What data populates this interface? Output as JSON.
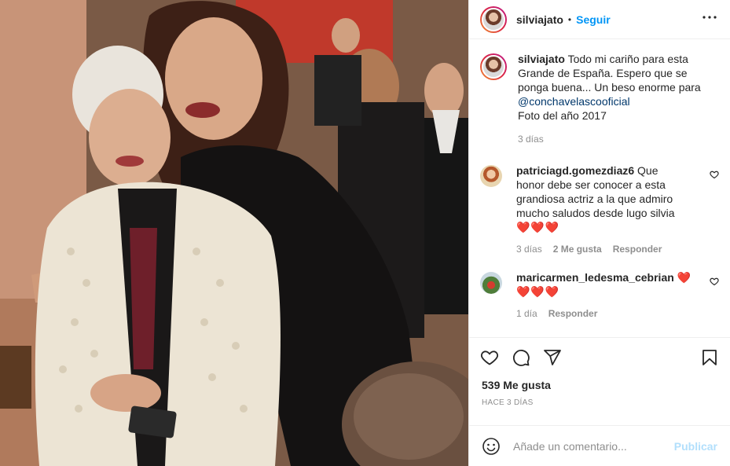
{
  "header": {
    "username": "silviajato",
    "separator": "•",
    "follow_label": "Seguir",
    "more_label": "•••"
  },
  "caption": {
    "username": "silviajato",
    "text_before": "Todo mi cariño para esta Grande de España. Espero que se ponga buena... Un beso enorme para ",
    "mention": "@conchavelascooficial",
    "text_after": "Foto del año 2017",
    "time": "3 días"
  },
  "comments": [
    {
      "username": "patriciagd.gomezdiaz6",
      "text": "Que honor debe ser conocer a esta grandiosa actriz a la que admiro mucho saludos desde lugo silvia",
      "hearts": "❤️❤️❤️",
      "time": "3 días",
      "likes": "2 Me gusta",
      "reply_label": "Responder"
    },
    {
      "username": "maricarmen_ledesma_cebrian",
      "text": "❤️",
      "hearts": "❤️❤️❤️",
      "time": "1 día",
      "reply_label": "Responder"
    }
  ],
  "likes_count": "539 Me gusta",
  "posted_ago": "HACE 3 DÍAS",
  "add_comment": {
    "placeholder": "Añade un comentario...",
    "publish_label": "Publicar"
  },
  "colors": {
    "link": "#0095f6",
    "publish_disabled": "#b2dffc",
    "heart": "#e0263c"
  },
  "icons": [
    "heart-icon",
    "comment-icon",
    "share-icon",
    "bookmark-icon",
    "emoji-icon",
    "more-icon"
  ]
}
